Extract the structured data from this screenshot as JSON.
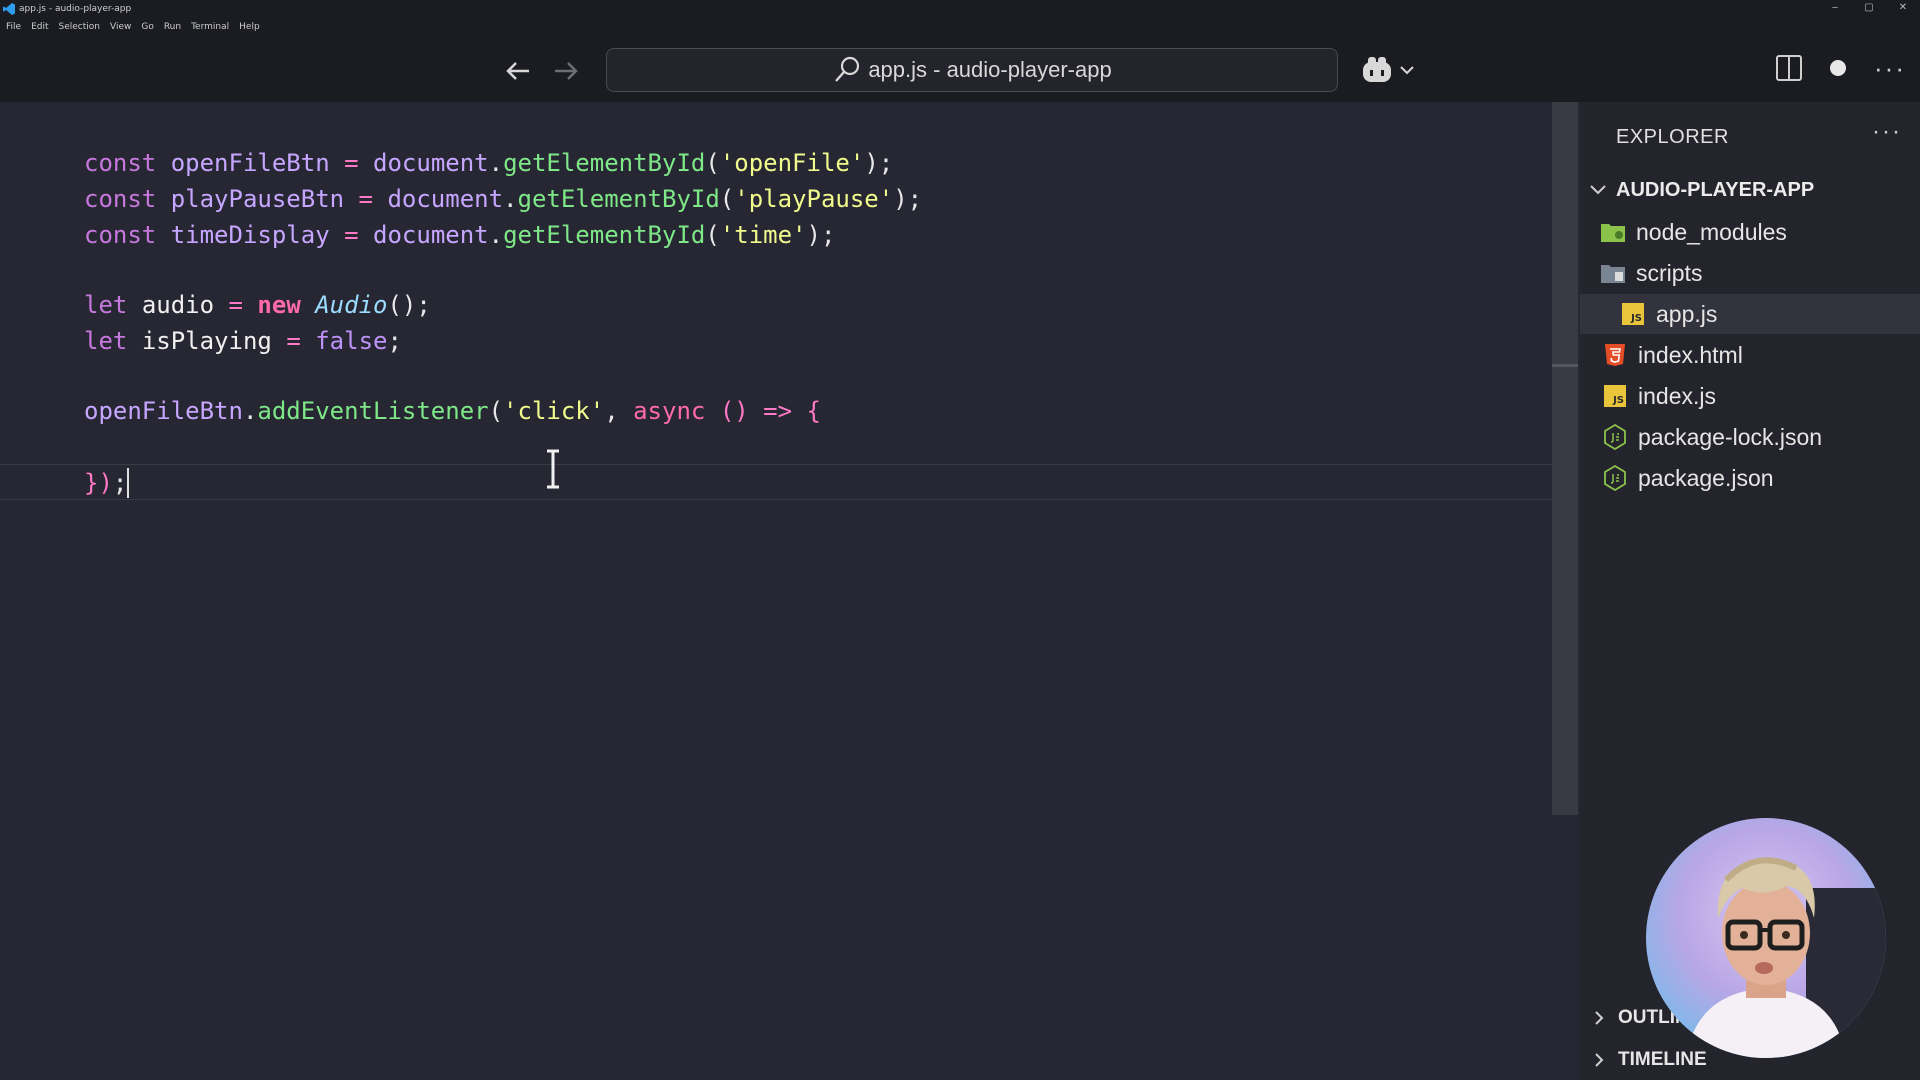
{
  "window": {
    "title": "app.js - audio-player-app",
    "controls": [
      "–",
      "▢",
      "✕"
    ]
  },
  "menu": [
    "File",
    "Edit",
    "Selection",
    "View",
    "Go",
    "Run",
    "Terminal",
    "Help"
  ],
  "toolbar": {
    "command_center_label": "app.js - audio-player-app"
  },
  "editor": {
    "lines": [
      [
        "const",
        "openFileBtn",
        "=",
        "document",
        ".",
        "getElementById",
        "(",
        "'openFile'",
        ");"
      ],
      [
        "const",
        "playPauseBtn",
        "=",
        "document",
        ".",
        "getElementById",
        "(",
        "'playPause'",
        ");"
      ],
      [
        "const",
        "timeDisplay",
        "=",
        "document",
        ".",
        "getElementById",
        "(",
        "'time'",
        ");"
      ],
      [
        "let",
        "audio",
        "=",
        "new",
        "Audio",
        "();"
      ],
      [
        "let",
        "isPlaying",
        "=",
        "false",
        ";"
      ],
      [
        "openFileBtn",
        ".",
        "addEventListener",
        "(",
        "'click'",
        ",",
        "async",
        "()",
        "=>",
        "{"
      ],
      [
        "})",
        ";"
      ]
    ]
  },
  "explorer": {
    "header": "EXPLORER",
    "root": "AUDIO-PLAYER-APP",
    "items": [
      {
        "label": "node_modules",
        "icon": "node-folder-icon"
      },
      {
        "label": "scripts",
        "icon": "scripts-folder-icon"
      },
      {
        "label": "app.js",
        "icon": "js-file-icon",
        "active": true
      },
      {
        "label": "index.html",
        "icon": "html5-file-icon"
      },
      {
        "label": "index.js",
        "icon": "js-file-icon"
      },
      {
        "label": "package-lock.json",
        "icon": "nodejs-file-icon"
      },
      {
        "label": "package.json",
        "icon": "nodejs-file-icon"
      }
    ],
    "js_badge": "JS",
    "sections": [
      "OUTLINE",
      "TIMELINE"
    ]
  },
  "colors": {
    "editor_bg": "#272733",
    "sidebar_bg": "#24242d",
    "keyword": "#c678dd",
    "function": "#7ee787",
    "string": "#f1fa8c"
  }
}
